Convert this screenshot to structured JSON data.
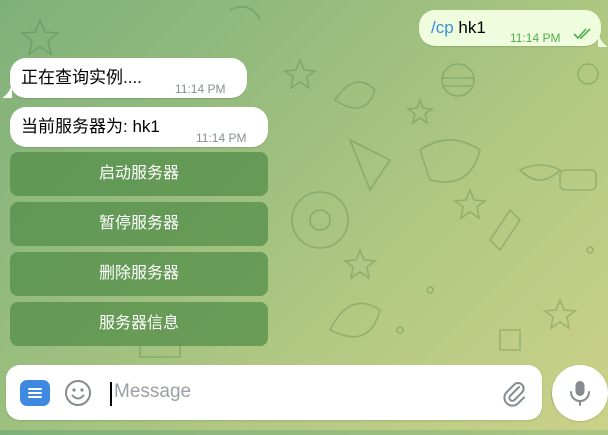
{
  "messages": [
    {
      "direction": "out",
      "command": "/cp",
      "text": " hk1",
      "time": "11:14 PM",
      "status": "read"
    },
    {
      "direction": "in",
      "text": "正在查询实例....",
      "time": "11:14 PM"
    },
    {
      "direction": "in",
      "text": "当前服务器为: hk1",
      "time": "11:14 PM"
    }
  ],
  "keyboard": {
    "buttons": [
      "启动服务器",
      "暂停服务器",
      "删除服务器",
      "服务器信息"
    ]
  },
  "composer": {
    "placeholder": "Message",
    "value": "",
    "menu_icon": "menu-icon",
    "emoji_icon": "emoji-icon",
    "attach_icon": "paperclip-icon",
    "mic_icon": "microphone-icon"
  },
  "colors": {
    "accent": "#3f8ae0",
    "outgoing_bubble": "#effdde",
    "read_ticks": "#4fae4e",
    "keyboard_button": "#5a9a50"
  }
}
